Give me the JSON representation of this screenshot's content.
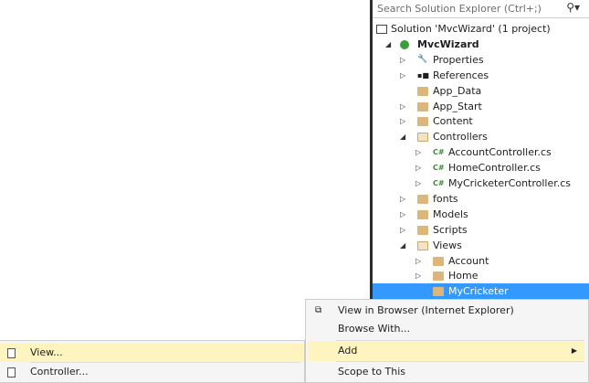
{
  "search": {
    "placeholder": "Search Solution Explorer (Ctrl+;)",
    "icon": "search-icon"
  },
  "tree": [
    {
      "label": "Solution 'MvcWizard' (1 project)",
      "level": 0,
      "icon": "solution-icon",
      "arrow": ""
    },
    {
      "label": "MvcWizard",
      "level": 1,
      "icon": "project-icon",
      "arrow": "expanded",
      "bold": true
    },
    {
      "label": "Properties",
      "level": 2,
      "icon": "wrench-icon",
      "arrow": "collapsed"
    },
    {
      "label": "References",
      "level": 2,
      "icon": "references-icon",
      "arrow": "collapsed"
    },
    {
      "label": "App_Data",
      "level": 2,
      "icon": "folder-icon",
      "arrow": ""
    },
    {
      "label": "App_Start",
      "level": 2,
      "icon": "folder-icon",
      "arrow": "collapsed"
    },
    {
      "label": "Content",
      "level": 2,
      "icon": "folder-icon",
      "arrow": "collapsed"
    },
    {
      "label": "Controllers",
      "level": 2,
      "icon": "folder-open-icon",
      "arrow": "expanded"
    },
    {
      "label": "AccountController.cs",
      "level": 3,
      "icon": "csharp-icon",
      "arrow": "collapsed"
    },
    {
      "label": "HomeController.cs",
      "level": 3,
      "icon": "csharp-icon",
      "arrow": "collapsed"
    },
    {
      "label": "MyCricketerController.cs",
      "level": 3,
      "icon": "csharp-icon",
      "arrow": "collapsed"
    },
    {
      "label": "fonts",
      "level": 2,
      "icon": "folder-icon",
      "arrow": "collapsed"
    },
    {
      "label": "Models",
      "level": 2,
      "icon": "folder-icon",
      "arrow": "collapsed"
    },
    {
      "label": "Scripts",
      "level": 2,
      "icon": "folder-icon",
      "arrow": "collapsed"
    },
    {
      "label": "Views",
      "level": 2,
      "icon": "folder-open-icon",
      "arrow": "expanded"
    },
    {
      "label": "Account",
      "level": 3,
      "icon": "folder-icon",
      "arrow": "collapsed"
    },
    {
      "label": "Home",
      "level": 3,
      "icon": "folder-icon",
      "arrow": "collapsed"
    },
    {
      "label": "MyCricketer",
      "level": 3,
      "icon": "folder-icon",
      "arrow": "",
      "selected": true
    }
  ],
  "context_menu": {
    "view_in_browser": "View in Browser (Internet Explorer)",
    "browse_with": "Browse With...",
    "add": "Add",
    "scope": "Scope to This"
  },
  "submenu": {
    "view": "View...",
    "controller": "Controller..."
  },
  "colors": {
    "selection": "#3399ff",
    "menu_highlight": "#fdf4bf"
  }
}
